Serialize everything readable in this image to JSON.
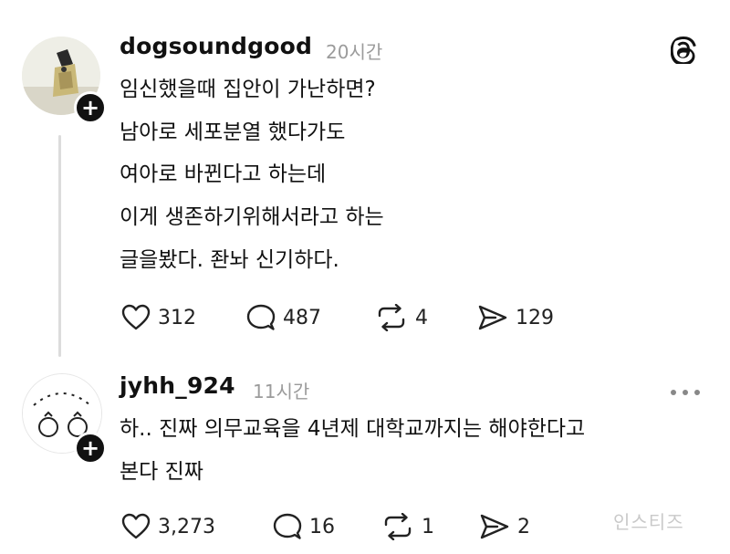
{
  "app": {
    "icon": "threads-icon"
  },
  "posts": [
    {
      "username": "dogsoundgood",
      "time": "20시간",
      "lines": [
        "임신했을때 집안이 가난하면?",
        "남아로 세포분열 했다가도",
        "여아로 바뀐다고 하는데",
        "이게 생존하기위해서라고 하는",
        "글을봤다. 좐놔 신기하다."
      ],
      "actions": {
        "likes": "312",
        "comments": "487",
        "reposts": "4",
        "shares": "129"
      }
    },
    {
      "username": "jyhh_924",
      "time": "11시간",
      "lines": [
        "하.. 진짜 의무교육을 4년제 대학교까지는 해야한다고",
        "본다 진짜"
      ],
      "actions": {
        "likes": "3,273",
        "comments": "16",
        "reposts": "1",
        "shares": "2"
      }
    }
  ],
  "follow_label": "+",
  "watermark": "인스티즈"
}
